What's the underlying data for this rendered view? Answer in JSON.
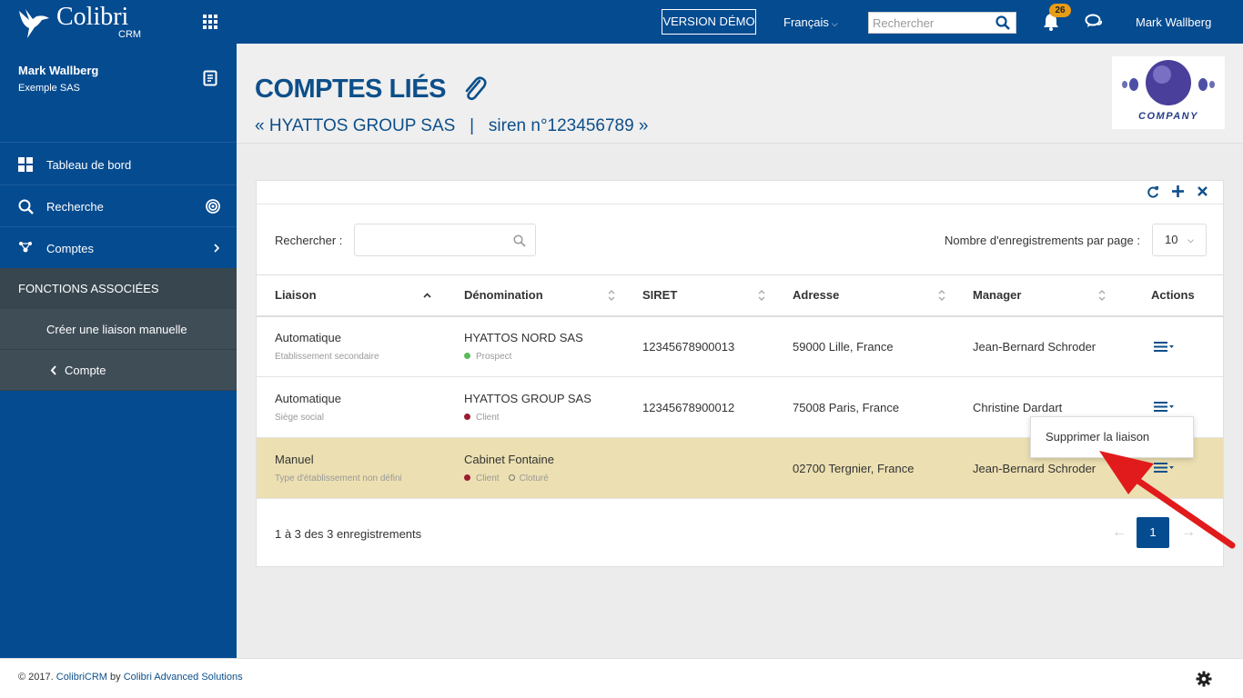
{
  "topbar": {
    "brand_name": "Colibri",
    "brand_sub": "CRM",
    "demo_label": "VERSION DÉMO",
    "language": "Français",
    "search_placeholder": "Rechercher",
    "notification_count": "26",
    "user_name": "Mark Wallberg",
    "color": "#054b90",
    "icons": [
      "colibri-bird-icon",
      "apps-grid-icon",
      "chevron-down-icon",
      "search-icon",
      "bell-icon",
      "chat-icon"
    ]
  },
  "sidebar": {
    "user_name": "Mark Wallberg",
    "company": "Exemple SAS",
    "items": [
      {
        "label": "Tableau de bord",
        "icon": "dashboard-icon"
      },
      {
        "label": "Recherche",
        "icon": "search-icon"
      },
      {
        "label": "Comptes",
        "icon": "accounts-icon"
      }
    ],
    "section_title": "FONCTIONS ASSOCIÉES",
    "sub_items": [
      {
        "label": "Créer une liaison manuelle"
      },
      {
        "label": "Compte",
        "icon": "chevron-left-icon"
      }
    ]
  },
  "header": {
    "title": "COMPTES LIÉS",
    "subtitle": "« HYATTOS GROUP SAS   |   siren n°123456789 »",
    "company_logo_text": "COMPANY"
  },
  "table_panel": {
    "search_label": "Rechercher :",
    "per_page_label": "Nombre d'enregistrements par page :",
    "per_page_value": "10",
    "columns": [
      "Liaison",
      "Dénomination",
      "SIRET",
      "Adresse",
      "Manager",
      "Actions"
    ],
    "rows": [
      {
        "liaison": "Automatique",
        "liaison_type": "Etablissement secondaire",
        "denomination": "HYATTOS NORD SAS",
        "status": "Prospect",
        "status_color": "#5cb85c",
        "siret": "12345678900013",
        "adresse": "59000 Lille, France",
        "manager": "Jean-Bernard Schroder"
      },
      {
        "liaison": "Automatique",
        "liaison_type": "Siège social",
        "denomination": "HYATTOS GROUP SAS",
        "status": "Client",
        "status_color": "#9b1b30",
        "siret": "12345678900012",
        "adresse": "75008 Paris, France",
        "manager": "Christine Dardart"
      },
      {
        "liaison": "Manuel",
        "liaison_type": "Type d'établissement non défini",
        "denomination": "Cabinet Fontaine",
        "status": "Client",
        "status_color": "#9b1b30",
        "status2": "Cloturé",
        "siret": "",
        "adresse": "02700 Tergnier, France",
        "manager": "Jean-Bernard Schroder"
      }
    ],
    "dropdown_item": "Supprimer la liaison",
    "info": "1 à 3 des 3 enregistrements",
    "pager": {
      "prev": "←",
      "current": "1",
      "next": "→"
    }
  },
  "footer": {
    "prefix": "© 2017. ",
    "brand": "ColibriCRM",
    "by": " by ",
    "company": "Colibri Advanced Solutions"
  }
}
